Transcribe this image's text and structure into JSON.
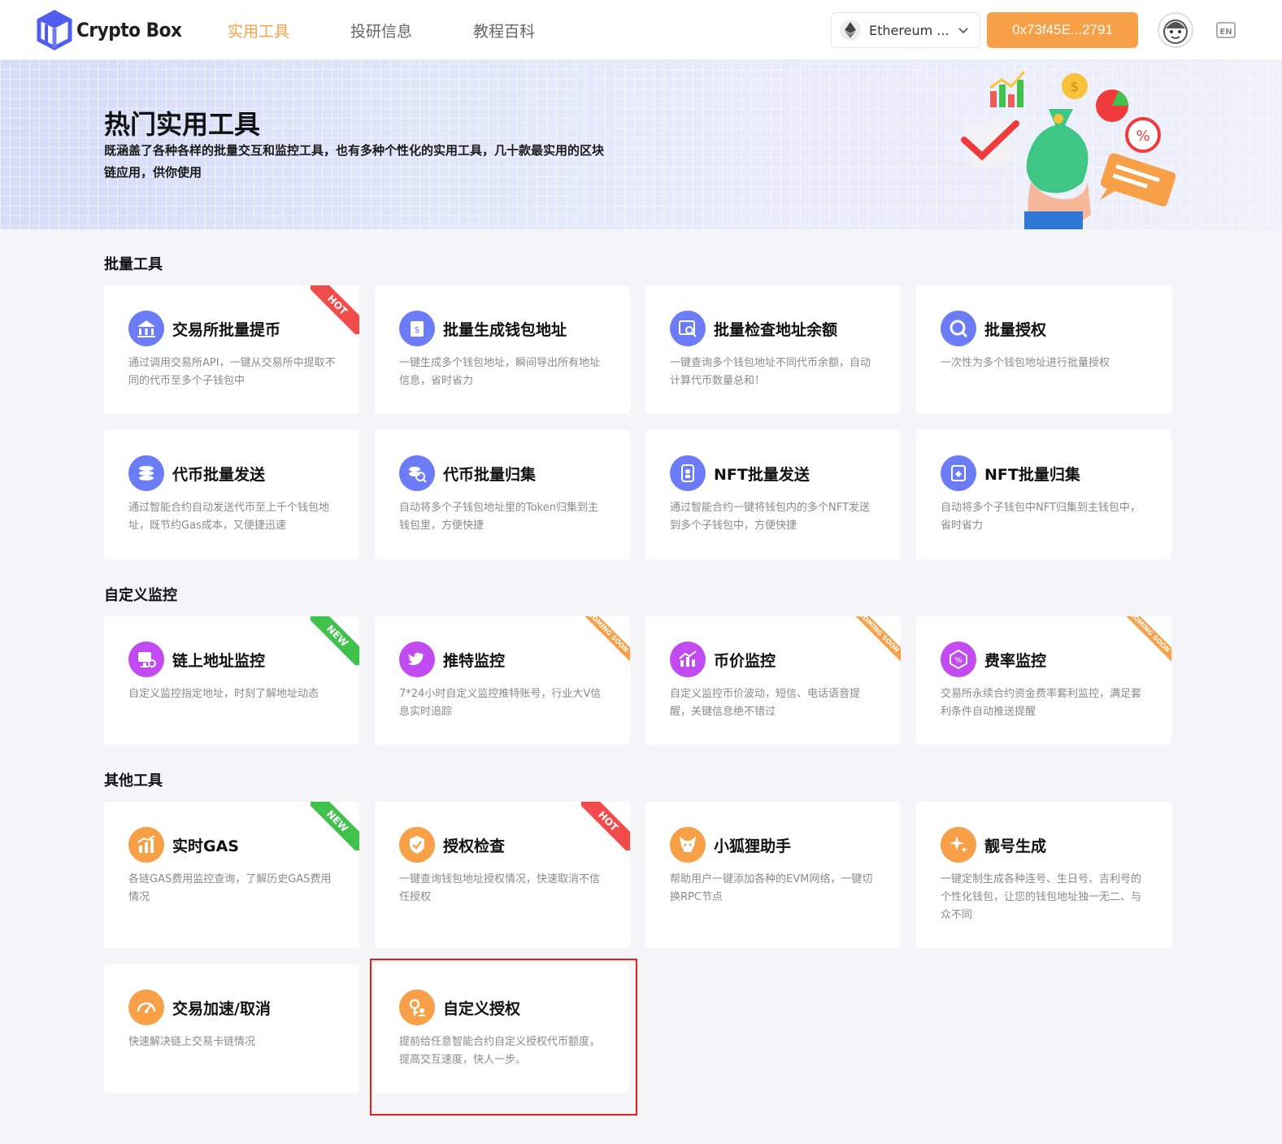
{
  "header": {
    "logo_text": "Crypto Box",
    "nav": [
      {
        "label": "实用工具",
        "active": true
      },
      {
        "label": "投研信息",
        "active": false
      },
      {
        "label": "教程百科",
        "active": false
      }
    ],
    "chain_select": {
      "value": "Ethereum ..."
    },
    "wallet_address": "0x73f45E...2791",
    "lang_icon": "EN"
  },
  "banner": {
    "title": "热门实用工具",
    "description": "既涵盖了各种各样的批量交互和监控工具，也有多种个性化的实用工具，几十款最实用的区块链应用，供你使用"
  },
  "sections": {
    "batch": {
      "title": "批量工具",
      "cards": [
        {
          "title": "交易所批量提币",
          "desc": "通过调用交易所API，一键从交易所中提取不同的代币至多个子钱包中",
          "badge": "HOT",
          "icon": "exchange-withdraw-icon"
        },
        {
          "title": "批量生成钱包地址",
          "desc": "一键生成多个钱包地址，瞬间导出所有地址信息，省时省力",
          "badge": "",
          "icon": "wallet-generate-icon"
        },
        {
          "title": "批量检查地址余额",
          "desc": "一键查询多个钱包地址不同代币余额，自动计算代币数量总和！",
          "badge": "",
          "icon": "balance-check-icon"
        },
        {
          "title": "批量授权",
          "desc": "一次性为多个钱包地址进行批量授权",
          "badge": "",
          "icon": "batch-approve-icon"
        },
        {
          "title": "代币批量发送",
          "desc": "通过智能合约自动发送代币至上千个钱包地址，既节约Gas成本，又便捷迅速",
          "badge": "",
          "icon": "token-send-icon"
        },
        {
          "title": "代币批量归集",
          "desc": "自动将多个子钱包地址里的Token归集到主钱包里，方便快捷",
          "badge": "",
          "icon": "token-collect-icon"
        },
        {
          "title": "NFT批量发送",
          "desc": "通过智能合约一键将钱包内的多个NFT发送到多个子钱包中，方便快捷",
          "badge": "",
          "icon": "nft-send-icon"
        },
        {
          "title": "NFT批量归集",
          "desc": "自动将多个子钱包中NFT归集到主钱包中，省时省力",
          "badge": "",
          "icon": "nft-collect-icon"
        }
      ]
    },
    "monitor": {
      "title": "自定义监控",
      "cards": [
        {
          "title": "链上地址监控",
          "desc": "自定义监控指定地址，时刻了解地址动态",
          "badge": "NEW",
          "icon": "address-monitor-icon"
        },
        {
          "title": "推特监控",
          "desc": "7*24小时自定义监控推特账号，行业大V信息实时追踪",
          "badge": "COMING SOON",
          "icon": "twitter-icon"
        },
        {
          "title": "币价监控",
          "desc": "自定义监控币价波动，短信、电话语音提醒，关键信息绝不错过",
          "badge": "COMING SOON",
          "icon": "price-chart-icon"
        },
        {
          "title": "费率监控",
          "desc": "交易所永续合约资金费率套利监控，满足套利条件自动推送提醒",
          "badge": "COMING SOON",
          "icon": "fee-rate-icon"
        }
      ]
    },
    "other": {
      "title": "其他工具",
      "cards": [
        {
          "title": "实时GAS",
          "desc": "各链GAS费用监控查询，了解历史GAS费用情况",
          "badge": "NEW",
          "icon": "gas-chart-icon"
        },
        {
          "title": "授权检查",
          "desc": "一键查询钱包地址授权情况，快速取消不信任授权",
          "badge": "HOT",
          "icon": "shield-check-icon"
        },
        {
          "title": "小狐狸助手",
          "desc": "帮助用户一键添加各种的EVM网络，一键切换RPC节点",
          "badge": "",
          "icon": "fox-icon"
        },
        {
          "title": "靓号生成",
          "desc": "一键定制生成各种连号、生日号、吉利号的个性化钱包，让您的钱包地址独一无二、与众不同",
          "badge": "",
          "icon": "sparkle-icon"
        },
        {
          "title": "交易加速/取消",
          "desc": "快速解决链上交易卡链情况",
          "badge": "",
          "icon": "speedometer-icon"
        },
        {
          "title": "自定义授权",
          "desc": "提前给任意智能合约自定义授权代币额度，提高交互速度，快人一步。",
          "badge": "",
          "icon": "key-user-icon"
        }
      ]
    }
  },
  "colors": {
    "accent": "#f8a048",
    "batch_icon": "#6b7cf6",
    "monitor_icon": "#c14bf0",
    "other_icon": "#f8a048",
    "hot": "#f24b4b",
    "new": "#3fc14b",
    "highlight": "#e02020"
  }
}
